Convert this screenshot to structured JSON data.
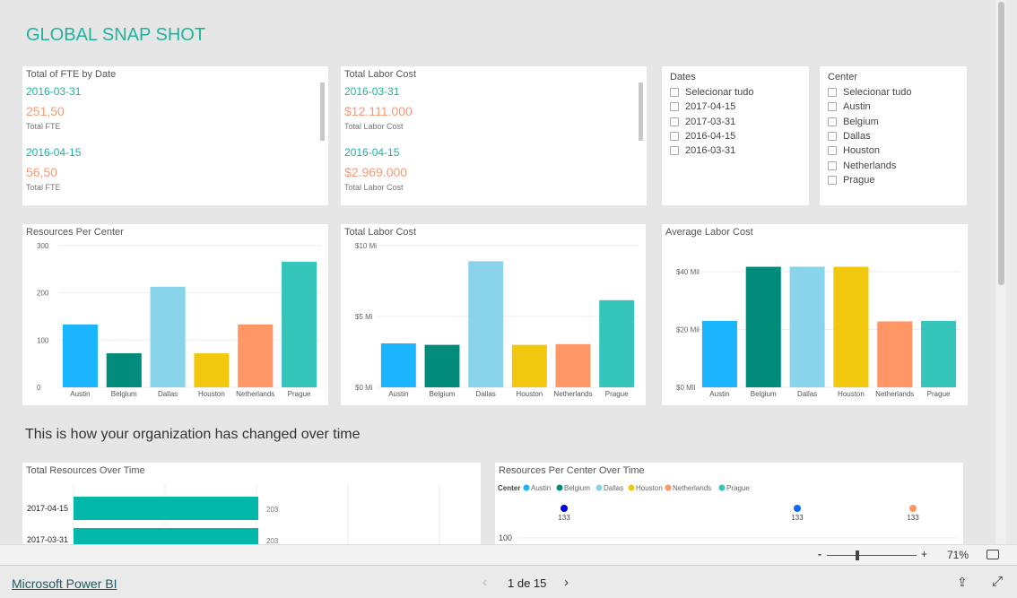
{
  "page_title": "GLOBAL SNAP SHOT",
  "subtitle": "This is how your organization has changed over time",
  "fte_card": {
    "title": "Total of FTE by Date",
    "rows": [
      {
        "date": "2016-03-31",
        "value": "251,50",
        "label": "Total FTE"
      },
      {
        "date": "2016-04-15",
        "value": "56,50",
        "label": "Total FTE"
      }
    ]
  },
  "labor_card": {
    "title": "Total Labor Cost",
    "rows": [
      {
        "date": "2016-03-31",
        "value": "$12.111.000",
        "label": "Total Labor Cost"
      },
      {
        "date": "2016-04-15",
        "value": "$2.969.000",
        "label": "Total Labor Cost"
      }
    ]
  },
  "dates_slicer": {
    "title": "Dates",
    "items": [
      "Selecionar tudo",
      "2017-04-15",
      "2017-03-31",
      "2016-04-15",
      "2016-03-31"
    ]
  },
  "center_slicer": {
    "title": "Center",
    "items": [
      "Selecionar tudo",
      "Austin",
      "Belgium",
      "Dallas",
      "Houston",
      "Netherlands",
      "Prague"
    ]
  },
  "colors": {
    "Austin": "#1ab5fd",
    "Belgium": "#008b7b",
    "Dallas": "#8ad4eb",
    "Houston": "#f2c80f",
    "Netherlands": "#fe9666",
    "Prague": "#35c5bb",
    "accent": "#20b2a0"
  },
  "chart_data": [
    {
      "type": "bar",
      "title": "Resources Per  Center",
      "categories": [
        "Austin",
        "Belgium",
        "Dallas",
        "Houston",
        "Netherlands",
        "Prague"
      ],
      "values": [
        133,
        72,
        213,
        72,
        133,
        266
      ],
      "ylim": [
        0,
        300
      ],
      "yticks": [
        "0",
        "100",
        "200",
        "300"
      ],
      "ytick_values": [
        0,
        100,
        200,
        300
      ],
      "grid": true
    },
    {
      "type": "bar",
      "title": "Total Labor Cost",
      "categories": [
        "Austin",
        "Belgium",
        "Dallas",
        "Houston",
        "Netherlands",
        "Prague"
      ],
      "values": [
        3.1,
        3.0,
        8.9,
        3.0,
        3.05,
        6.15
      ],
      "ylim": [
        0,
        10
      ],
      "yticks": [
        "$0 Mi",
        "$5 Mi",
        "$10 Mi"
      ],
      "ytick_values": [
        0,
        5,
        10
      ],
      "grid": true
    },
    {
      "type": "bar",
      "title": "Average Labor Cost",
      "categories": [
        "Austin",
        "Belgium",
        "Dallas",
        "Houston",
        "Netherlands",
        "Prague"
      ],
      "values": [
        23,
        41.7,
        41.7,
        41.7,
        22.8,
        23
      ],
      "ylim": [
        0,
        49
      ],
      "yticks": [
        "$0 Mil",
        "$20 Mil",
        "$40 Mil"
      ],
      "ytick_values": [
        0,
        20,
        40
      ],
      "grid": true
    },
    {
      "type": "bar",
      "orientation": "horizontal",
      "title": "Total Resources Over Time",
      "categories": [
        "2017-04-15",
        "2017-03-31"
      ],
      "values": [
        203,
        203
      ],
      "data_labels": [
        "203",
        "203"
      ]
    },
    {
      "type": "scatter",
      "title": "Resources Per Center Over Time",
      "legend_title": "Center",
      "legend": [
        "Austin",
        "Belgium",
        "Dallas",
        "Houston",
        "Netherlands",
        "Prague"
      ],
      "legend_placement": "top-left",
      "points": [
        {
          "label": "133",
          "series": "Austin"
        },
        {
          "label": "133",
          "series": "Austin"
        },
        {
          "label": "133",
          "series": "Netherlands"
        }
      ],
      "yticks": [
        "100"
      ]
    }
  ],
  "zoom": {
    "minus": "-",
    "plus": "+",
    "level": "71%"
  },
  "footer": {
    "brand": "Microsoft Power BI",
    "page": "1 de 15"
  }
}
